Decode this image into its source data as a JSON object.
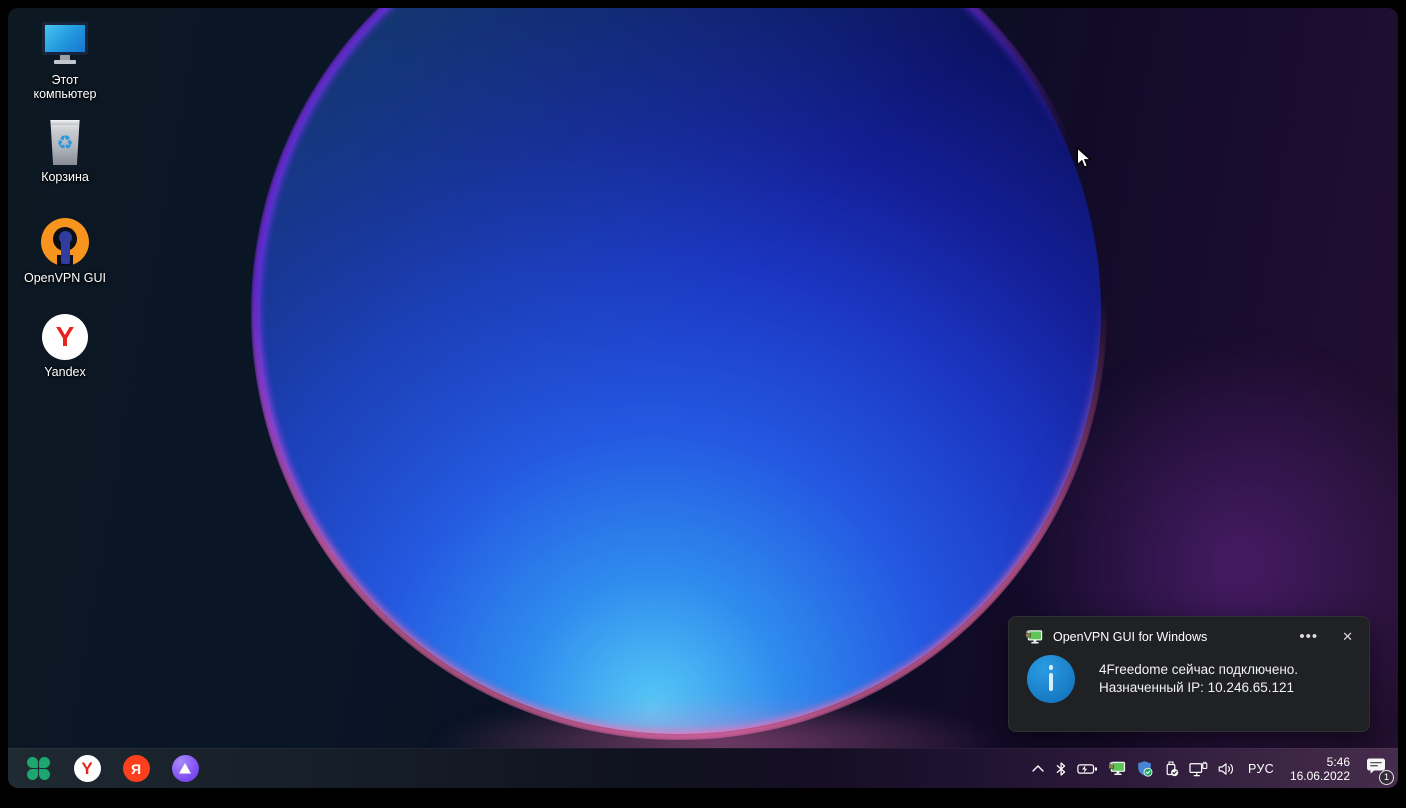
{
  "desktop": {
    "icons": [
      {
        "label": "Этот компьютер"
      },
      {
        "label": "Корзина"
      },
      {
        "label": "OpenVPN GUI"
      },
      {
        "label": "Yandex"
      }
    ],
    "recycle_glyph": "♻"
  },
  "toast": {
    "title": "OpenVPN GUI for Windows",
    "more_glyph": "•••",
    "close_glyph": "✕",
    "message_line1": "4Freedome сейчас подключено.",
    "message_line2": "Назначенный IP: 10.246.65.121"
  },
  "taskbar": {
    "pinned": [
      {
        "name": "start-clover"
      },
      {
        "name": "yandex-browser",
        "glyph": "Y"
      },
      {
        "name": "yandex-search",
        "glyph": "Я"
      },
      {
        "name": "alice-assistant"
      }
    ],
    "tray": {
      "icons": [
        "hidden-icons-chevron",
        "bluetooth",
        "battery-charging",
        "openvpn-connected",
        "windows-security",
        "safely-remove-hardware",
        "network-ethernet",
        "volume"
      ],
      "language": "РУС",
      "time": "5:46",
      "date": "16.06.2022",
      "notification_count": "1"
    }
  },
  "colors": {
    "bloom_blue": "#2f8cee",
    "bloom_cyan": "#55c9f6",
    "bloom_violet_rim": "#7a2ff2",
    "bloom_pink_rim": "#f66eac",
    "toast_bg": "#202125",
    "info_blue": "#1b87d0",
    "openvpn_orange": "#f7941d",
    "yandex_red": "#e5261f",
    "yandex_search_red": "#fc3f1d",
    "alice_purple": "#7b46f0",
    "clover_green": "#1ca770",
    "security_green": "#16a85a"
  }
}
